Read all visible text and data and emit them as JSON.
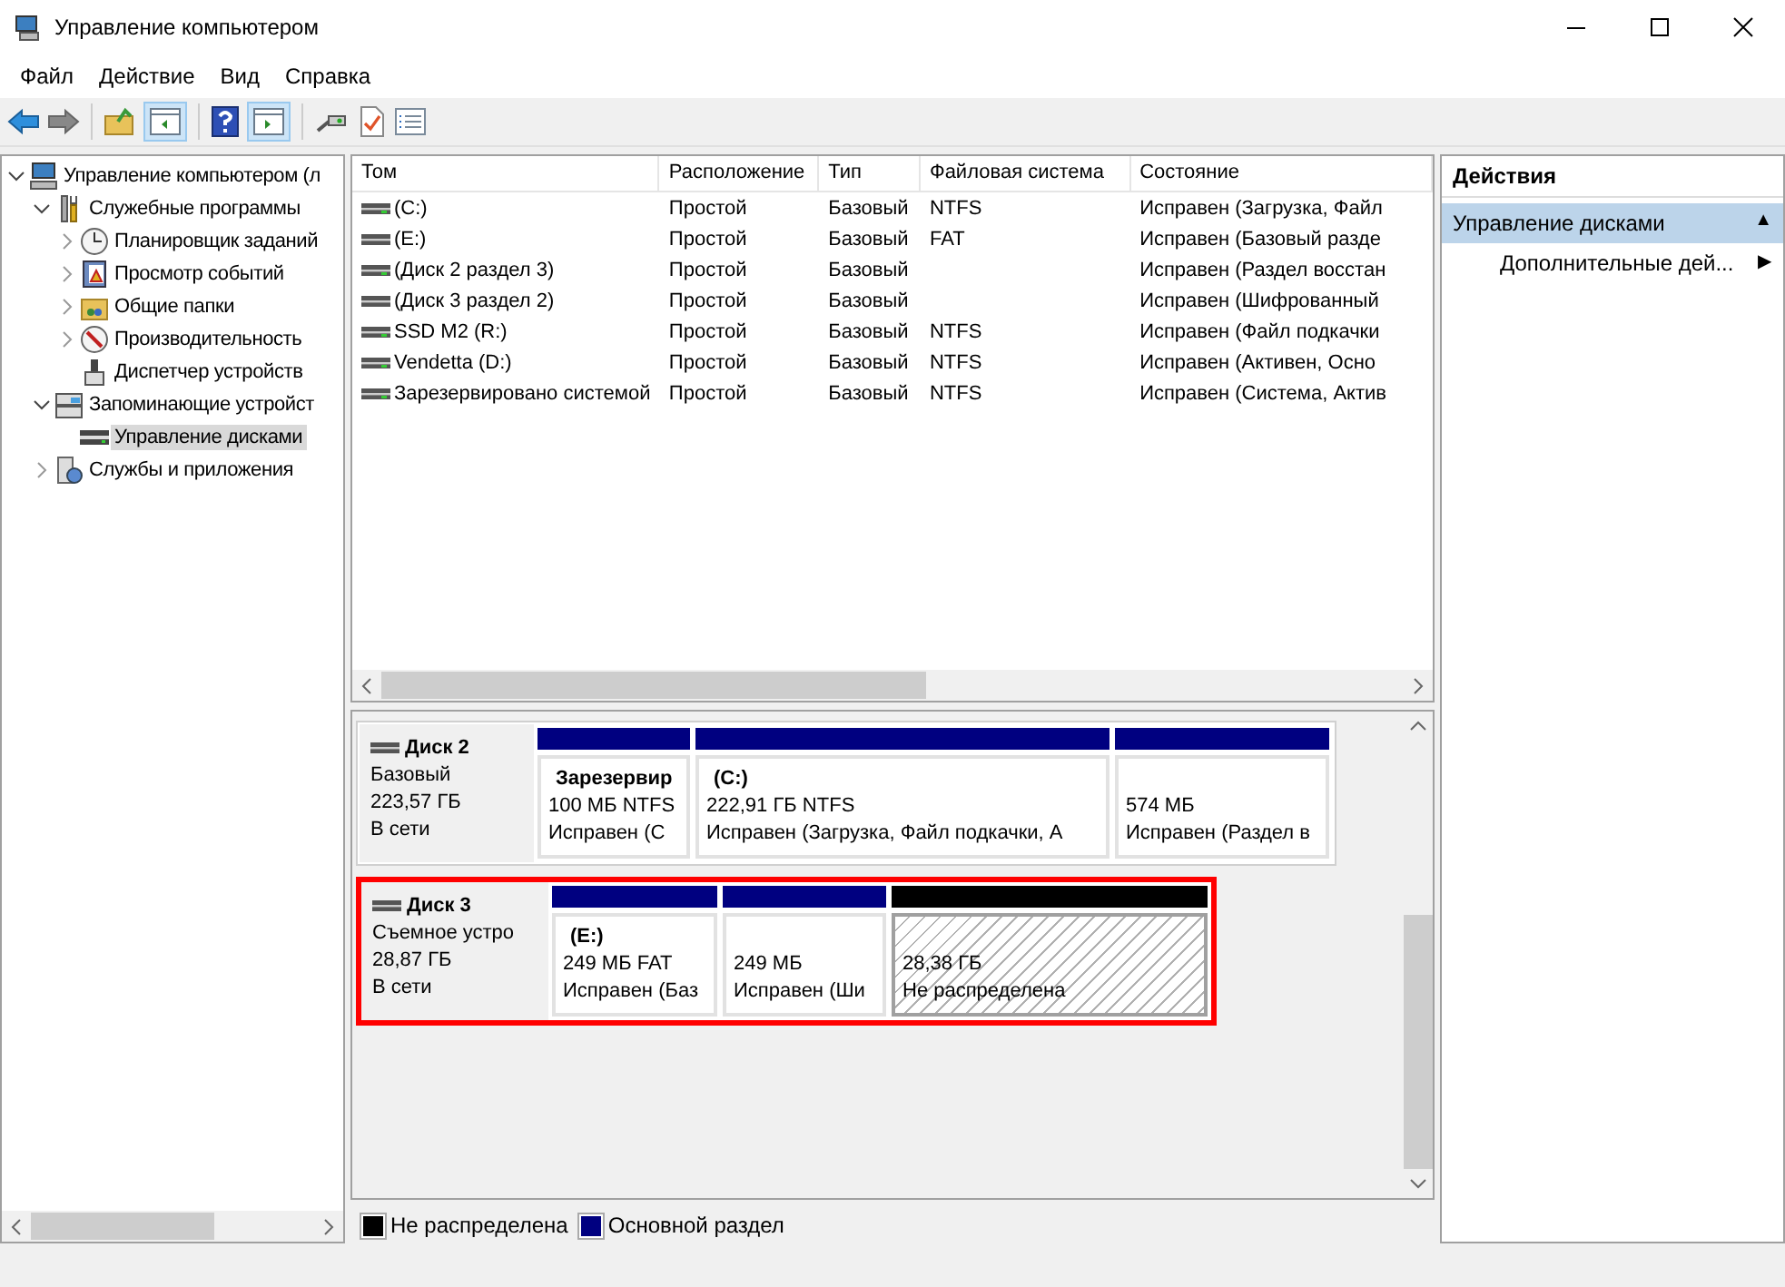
{
  "window": {
    "title": "Управление компьютером"
  },
  "menu": [
    "Файл",
    "Действие",
    "Вид",
    "Справка"
  ],
  "tree": [
    {
      "label": "Управление компьютером (л",
      "expanded": true,
      "selected": false,
      "children": [
        {
          "label": "Служебные программы",
          "expanded": true,
          "selected": false,
          "children": [
            {
              "label": "Планировщик заданий",
              "expanded": false,
              "selected": false
            },
            {
              "label": "Просмотр событий",
              "expanded": false,
              "selected": false
            },
            {
              "label": "Общие папки",
              "expanded": false,
              "selected": false
            },
            {
              "label": "Производительность",
              "expanded": false,
              "selected": false
            },
            {
              "label": "Диспетчер устройств",
              "selected": false
            }
          ]
        },
        {
          "label": "Запоминающие устройст",
          "expanded": true,
          "selected": false,
          "children": [
            {
              "label": "Управление дисками",
              "selected": true
            }
          ]
        },
        {
          "label": "Службы и приложения",
          "expanded": false,
          "selected": false
        }
      ]
    }
  ],
  "table": {
    "columns": [
      "Том",
      "Расположение",
      "Тип",
      "Файловая система",
      "Состояние"
    ],
    "rows": [
      {
        "led": true,
        "cells": [
          " (C:)",
          "Простой",
          "Базовый",
          "NTFS",
          "Исправен (Загрузка, Файл"
        ]
      },
      {
        "led": false,
        "cells": [
          " (E:)",
          "Простой",
          "Базовый",
          "FAT",
          "Исправен (Базовый разде"
        ]
      },
      {
        "led": true,
        "cells": [
          "(Диск 2 раздел 3)",
          "Простой",
          "Базовый",
          "",
          "Исправен (Раздел восстан"
        ]
      },
      {
        "led": false,
        "cells": [
          "(Диск 3 раздел 2)",
          "Простой",
          "Базовый",
          "",
          "Исправен (Шифрованный"
        ]
      },
      {
        "led": true,
        "cells": [
          "SSD M2 (R:)",
          "Простой",
          "Базовый",
          "NTFS",
          "Исправен (Файл подкачки"
        ]
      },
      {
        "led": true,
        "cells": [
          "Vendetta (D:)",
          "Простой",
          "Базовый",
          "NTFS",
          "Исправен (Активен, Осно"
        ]
      },
      {
        "led": true,
        "cells": [
          "Зарезервировано системой",
          "Простой",
          "Базовый",
          "NTFS",
          "Исправен (Система, Актив"
        ]
      }
    ]
  },
  "disks": [
    {
      "name": "Диск 2",
      "type": "Базовый",
      "size": "223,57 ГБ",
      "status": "В сети",
      "selected": false,
      "partitions": [
        {
          "kind": "primary",
          "title": "Зарезервир",
          "size": "100 МБ NTFS",
          "status": "Исправен (С"
        },
        {
          "kind": "primary",
          "title": "(C:)",
          "size": "222,91 ГБ NTFS",
          "status": "Исправен (Загрузка, Файл подкачки, А"
        },
        {
          "kind": "primary",
          "size": "574 МБ",
          "status": "Исправен (Раздел в"
        }
      ]
    },
    {
      "name": "Диск 3",
      "type": "Съемное устро",
      "size": "28,87 ГБ",
      "status": "В сети",
      "selected": true,
      "partitions": [
        {
          "kind": "primary",
          "title": "(E:)",
          "size": "249 МБ FAT",
          "status": "Исправен (Баз"
        },
        {
          "kind": "primary",
          "size": "249 МБ",
          "status": "Исправен (Ши"
        },
        {
          "kind": "unallocated",
          "size": "28,38 ГБ",
          "status": "Не распределена"
        }
      ]
    }
  ],
  "legend": [
    {
      "kind": "unallocated",
      "label": "Не распределена",
      "color": "#000000"
    },
    {
      "kind": "primary",
      "label": "Основной раздел",
      "color": "#000080"
    }
  ],
  "actions": {
    "title": "Действия",
    "section": "Управление дисками",
    "section_glyph": "▲",
    "items": [
      {
        "label": "Дополнительные дей...",
        "glyph": "▶"
      }
    ]
  }
}
